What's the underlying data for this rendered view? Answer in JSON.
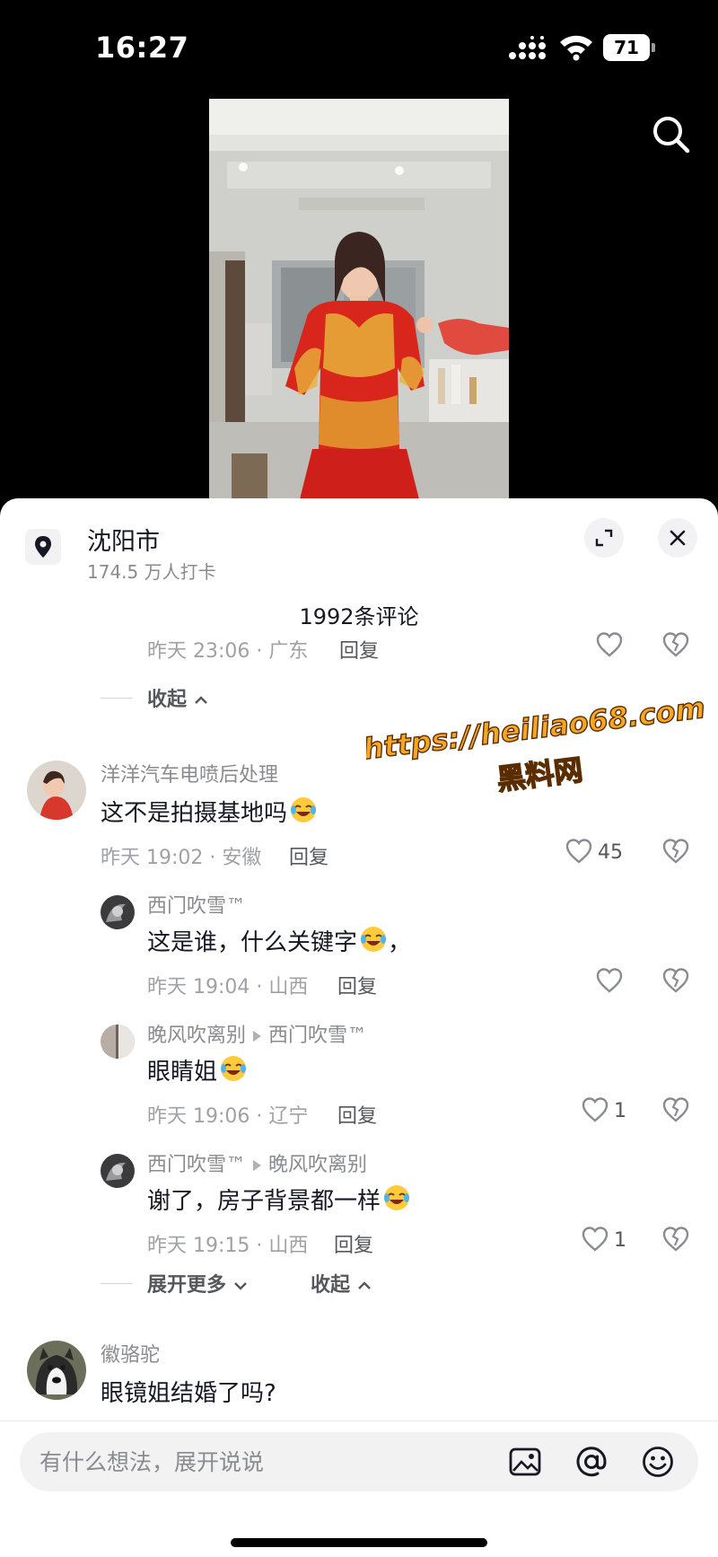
{
  "status_bar": {
    "time": "16:27",
    "battery": "71"
  },
  "location": {
    "city": "沈阳市",
    "checkins": "174.5 万人打卡"
  },
  "comments_header": {
    "count_label": "1992条评论"
  },
  "comments": {
    "prev_meta": {
      "time_loc": "昨天 23:06 · 广东",
      "reply": "回复"
    },
    "collapse_1": "收起",
    "c1": {
      "user": "洋洋汽车电喷后处理",
      "text": "这不是拍摄基地吗",
      "time_loc": "昨天 19:02 · 安徽",
      "reply": "回复",
      "likes": "45"
    },
    "r1": {
      "user": "西门吹雪™",
      "text": "这是谁，什么关键字",
      "text_tail": "，",
      "time_loc": "昨天 19:04 · 山西",
      "reply": "回复"
    },
    "r2": {
      "user": "晚风吹离别",
      "reply_to": "西门吹雪™",
      "text": "眼睛姐",
      "time_loc": "昨天 19:06 · 辽宁",
      "reply": "回复",
      "likes": "1"
    },
    "r3": {
      "user": "西门吹雪™",
      "reply_to": "晚风吹离别",
      "text": "谢了，房子背景都一样",
      "time_loc": "昨天 19:15 · 山西",
      "reply": "回复",
      "likes": "1"
    },
    "expand_more": "展开更多",
    "collapse_2": "收起",
    "c2": {
      "user": "徽骆驼",
      "text": "眼镜姐结婚了吗?"
    }
  },
  "watermark": {
    "line1": "https://heiliao68.com",
    "line2": "黑料网"
  },
  "input": {
    "placeholder": "有什么想法，展开说说"
  },
  "colors": {
    "watermark_fill": "#f5a623",
    "watermark_stroke": "#5a2d00",
    "dress_red": "#d8261c",
    "gold": "#e8b23a"
  }
}
